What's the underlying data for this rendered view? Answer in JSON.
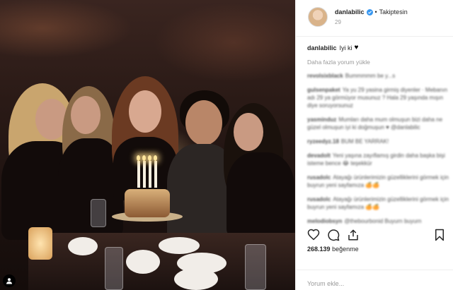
{
  "post": {
    "username": "danlabilic",
    "follow_label": "Takiptesin",
    "separator": "•",
    "subline": "29",
    "caption_user": "danlabilic",
    "caption_text": "Iyi ki",
    "caption_emoji": "♥",
    "load_more": "Daha fazla yorum yükle",
    "likes_count": "268.139",
    "likes_word": "beğenme",
    "comment_placeholder": "Yorum ekle..."
  },
  "comments": [
    {
      "user": "revolsixblack",
      "text": "Bummmmm be y...s"
    },
    {
      "user": "gulsenpaket",
      "text": "Ya yu 29 yasina girmiş diyenler · Mebanın adı 29 ya görmüyor musunuz ? Hala 29 yaşında mışın diye soruyorsunuz"
    },
    {
      "user": "yasminduz",
      "text": "Mumları daha mum olmuşun bizi daha ne güzel olmuşun iyi ki doğmuşun ♥ @danlabilic"
    },
    {
      "user": "ryzeedyz.18",
      "text": "BUM BE YARRAK!"
    },
    {
      "user": "devadolt",
      "text": "Yeni yaşına zayıflamış girdin daha başka bişi isteme bence 😂 teşekkür"
    },
    {
      "user": "rusadolc",
      "text": "Atayağı ürünlerimizin güzelliklerini görmek için buyrun yeni sayfamıza 🍊🍊"
    },
    {
      "user": "rusadolc",
      "text": "Atayağı ürünlerimizin güzelliklerini görmek için buyrun yeni sayfamıza 🍊🍊"
    },
    {
      "user": "melodiobsyn",
      "text": "@thebourbonid Buyurn buyurn"
    }
  ],
  "icons": {
    "like": "heart-icon",
    "comment": "comment-icon",
    "share": "share-icon",
    "save": "bookmark-icon",
    "verified": "verified-badge-icon",
    "user_tag": "user-tag-icon"
  },
  "colors": {
    "verified": "#3897f0",
    "muted": "#999999",
    "text": "#262626",
    "border": "#efefef"
  }
}
